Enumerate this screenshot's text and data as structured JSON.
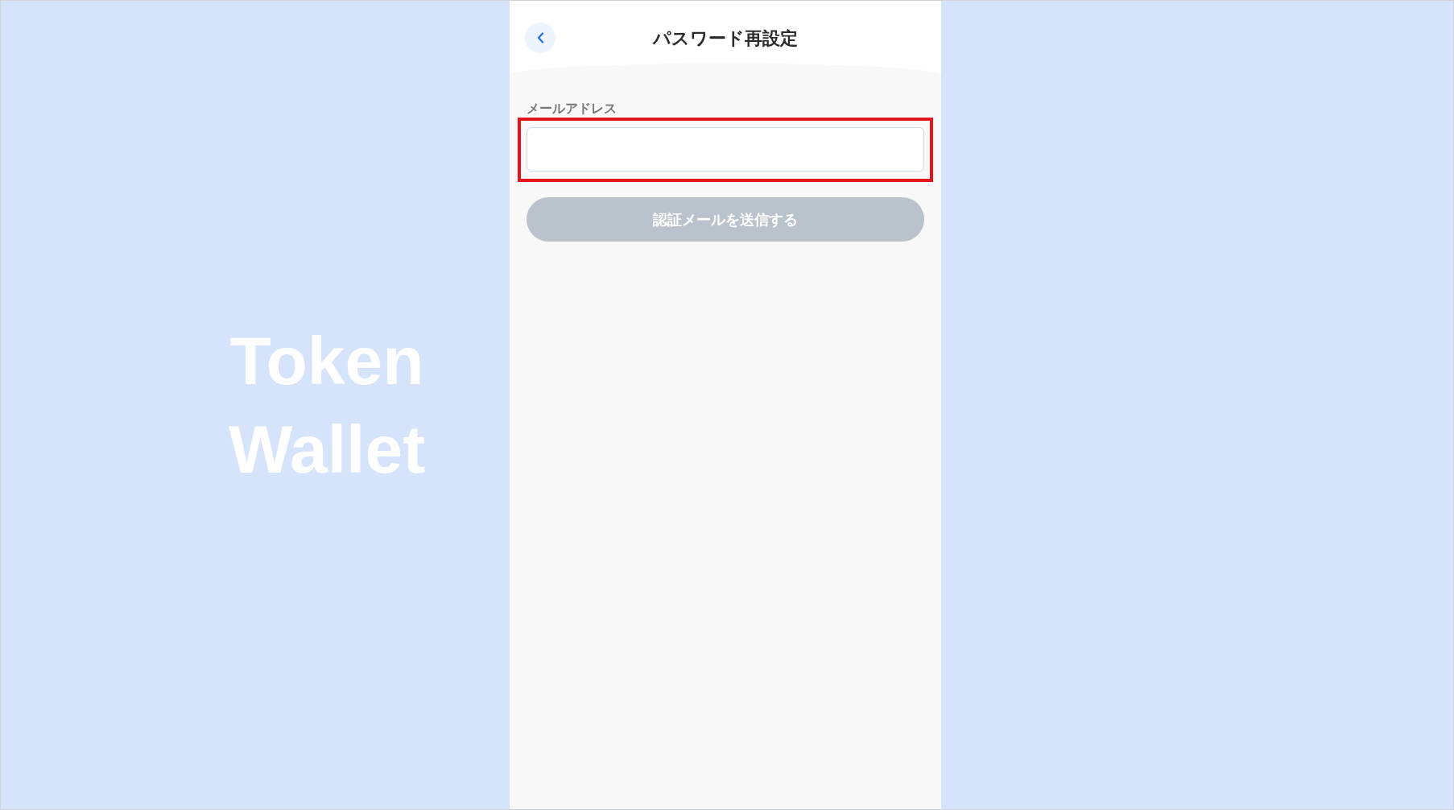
{
  "brand": {
    "title": "Token Wallet"
  },
  "header": {
    "title": "パスワード再設定"
  },
  "form": {
    "email_field": {
      "label": "メールアドレス",
      "highlighted": true
    },
    "submit_button": {
      "label": "認証メールを送信する",
      "disabled": true
    }
  }
}
